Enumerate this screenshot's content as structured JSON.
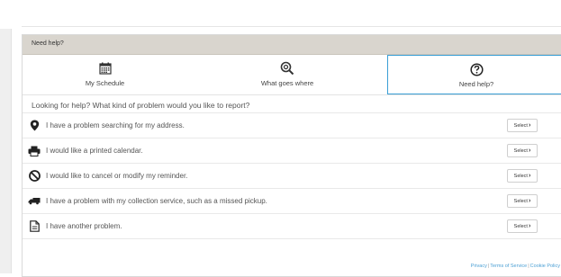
{
  "widget": {
    "header": "Need help?",
    "tabs": [
      {
        "label": "My Schedule",
        "icon": "calendar-icon"
      },
      {
        "label": "What goes where",
        "icon": "search-icon"
      },
      {
        "label": "Need help?",
        "icon": "question-icon",
        "active": true
      }
    ],
    "question": "Looking for help? What kind of problem would you like to report?",
    "rows": [
      {
        "text": "I have a problem searching for my address.",
        "icon": "map-pin-icon",
        "button": "Select"
      },
      {
        "text": "I would like a printed calendar.",
        "icon": "printer-icon",
        "button": "Select"
      },
      {
        "text": "I would like to cancel or modify my reminder.",
        "icon": "cancel-icon",
        "button": "Select"
      },
      {
        "text": "I have a problem with my collection service, such as a missed pickup.",
        "icon": "truck-icon",
        "button": "Select"
      },
      {
        "text": "I have another problem.",
        "icon": "document-icon",
        "button": "Select"
      }
    ],
    "footer": {
      "privacy": "Privacy",
      "terms": "Terms of Service",
      "cookie": "Cookie Policy",
      "separator": "|"
    }
  },
  "colors": {
    "accent": "#3a9fd6",
    "header_bg": "#d9d5ce",
    "link": "#4a9fd4"
  }
}
